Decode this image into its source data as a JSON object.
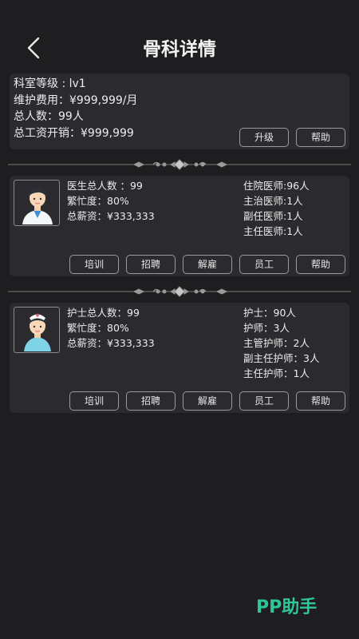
{
  "header": {
    "title": "骨科详情",
    "back_icon": "chevron-left-icon"
  },
  "department": {
    "level": "科室等级 : lv1",
    "maintenance": "维护费用：¥999,999/月",
    "headcount": "总人数：99人",
    "salary_total": "总工资开销：¥999,999",
    "buttons": {
      "upgrade": "升级",
      "help": "帮助"
    }
  },
  "doctors": {
    "avatar_icon": "doctor-avatar-icon",
    "total": "医生总人数 ：99",
    "busy": "繁忙度：80%",
    "salary": "总薪资：¥333,333",
    "ranks": [
      "住院医师:96人",
      "主治医师:1人",
      "副任医师:1人",
      "主任医师:1人"
    ],
    "buttons": {
      "train": "培训",
      "recruit": "招聘",
      "dismiss": "解雇",
      "staff": "员工",
      "help": "帮助"
    }
  },
  "nurses": {
    "avatar_icon": "nurse-avatar-icon",
    "total": "护士总人数：99",
    "busy": "繁忙度：80%",
    "salary": "总薪资：¥333,333",
    "ranks": [
      "护士：90人",
      "护师：3人",
      "主管护师：2人",
      "副主任护师：3人",
      "主任护师：1人"
    ],
    "buttons": {
      "train": "培训",
      "recruit": "招聘",
      "dismiss": "解雇",
      "staff": "员工",
      "help": "帮助"
    }
  },
  "watermark": "PP助手",
  "colors": {
    "background": "#1e1e20",
    "card": "#2b2b2f",
    "brand": "#2fc59b"
  }
}
